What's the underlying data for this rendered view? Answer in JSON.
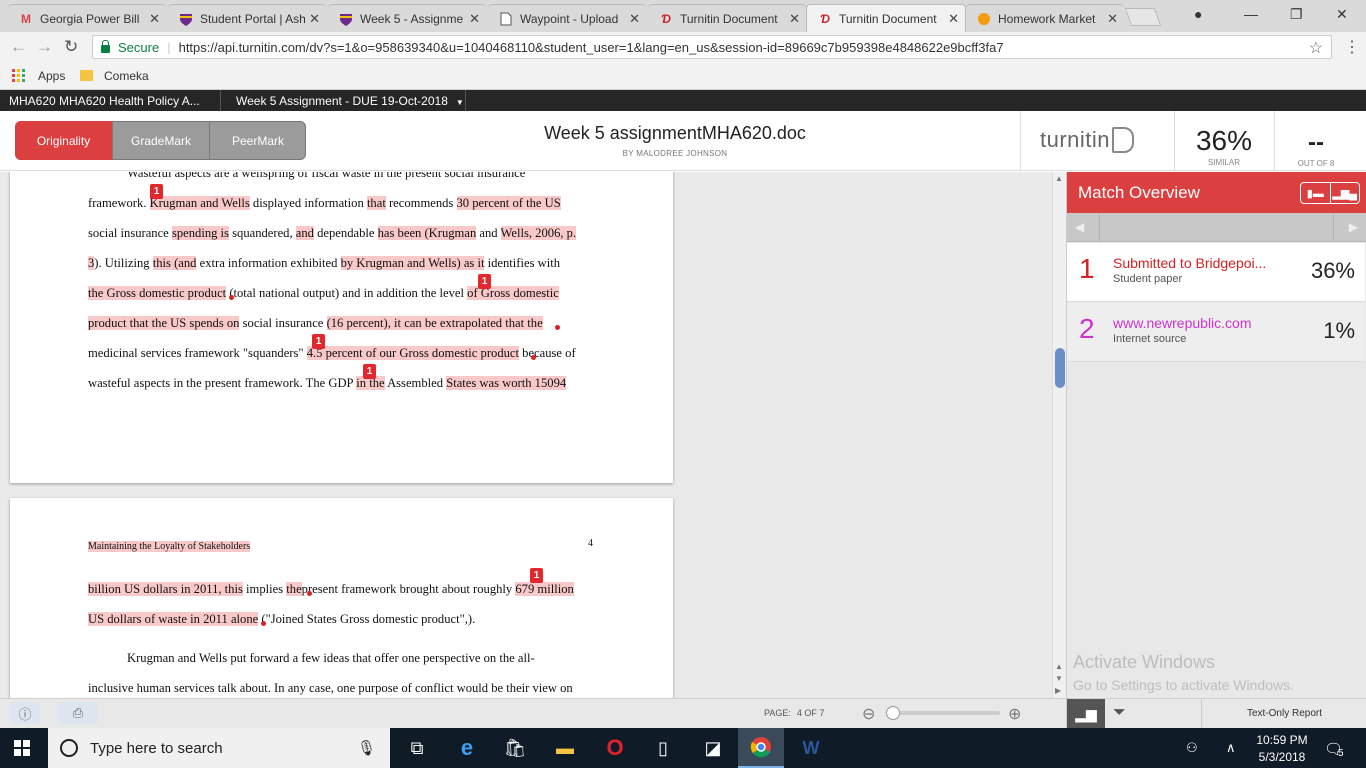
{
  "browser": {
    "tabs": [
      {
        "title": "Georgia Power Bill",
        "icon": "gmail-icon",
        "active": false
      },
      {
        "title": "Student Portal | Ash",
        "icon": "shield-icon",
        "active": false
      },
      {
        "title": "Week 5 - Assignme",
        "icon": "shield-icon",
        "active": false
      },
      {
        "title": "Waypoint - Upload",
        "icon": "document-icon",
        "active": false
      },
      {
        "title": "Turnitin Document",
        "icon": "turnitin-icon",
        "active": false
      },
      {
        "title": "Turnitin Document",
        "icon": "turnitin-icon",
        "active": true
      },
      {
        "title": "Homework Market",
        "icon": "homework-icon",
        "active": false
      }
    ],
    "secure_label": "Secure",
    "url": "https://api.turnitin.com/dv?s=1&o=958639340&u=1040468110&student_user=1&lang=en_us&session-id=89669c7b959398e4848622e9bcff3fa7",
    "bookmarks": {
      "apps": "Apps",
      "folder": "Comeka"
    }
  },
  "turnitin": {
    "breadcrumb_class": "MHA620 MHA620 Health Policy A...",
    "breadcrumb_assignment": "Week 5 Assignment - DUE 19-Oct-2018",
    "modes": [
      "Originality",
      "GradeMark",
      "PeerMark"
    ],
    "doc_title": "Week 5 assignmentMHA620.doc",
    "doc_author": "BY MALODREE JOHNSON",
    "logo": "turnitin",
    "similarity": "36%",
    "similarity_label": "SIMILAR",
    "grade": "--",
    "grade_label": "OUT OF 8"
  },
  "document": {
    "page1_lines": [
      "Wasteful aspects are a wellspring of fiscal waste in the present social insurance",
      "framework.",
      "Krugman and Wells",
      "displayed information",
      "that",
      "recommends",
      "30 percent of the US",
      "social insurance",
      "spending is",
      "squandered,",
      "and",
      "dependable",
      "has been (Krugman",
      "and",
      "Wells, 2006, p.",
      "3",
      "). Utilizing",
      "this (and",
      "extra information exhibited",
      "by Krugman and Wells) as it",
      "identifies with",
      "the Gross domestic product",
      "(total national output) and in addition the level",
      "of Gross domestic",
      "product that the US spends on",
      "social insurance",
      "(16 percent), it can be extrapolated that the",
      "medicinal services framework \"squanders\"",
      "4.5 percent of our Gross domestic product",
      "because of",
      "wasteful aspects in the present framework. The GDP",
      "in the",
      "Assembled",
      "States was worth 15094"
    ],
    "page2_header": "Maintaining the Loyalty of Stakeholders",
    "page2_number": "4",
    "page2_lines": [
      "billion US dollars in 2011, this",
      "implies",
      "the",
      "present framework brought about roughly",
      "679 million",
      "US dollars of waste in 2011 alone",
      "(\"Joined States Gross domestic product\",).",
      "Krugman and Wells put forward a few ideas that offer one perspective on the all-",
      "inclusive human services talk about. In any case, one purpose of conflict would be their view on"
    ],
    "match_marker": "1"
  },
  "panel": {
    "title": "Match Overview",
    "matches": [
      {
        "rank": "1",
        "source": "Submitted to Bridgepoi...",
        "type": "Student paper",
        "percent": "36%",
        "color": "#d42222"
      },
      {
        "rank": "2",
        "source": "www.newrepublic.com",
        "type": "Internet source",
        "percent": "1%",
        "color": "#cc33cc"
      }
    ],
    "watermark_title": "Activate Windows",
    "watermark_sub": "Go to Settings to activate Windows."
  },
  "status": {
    "page_label": "PAGE:",
    "page_value": "4 OF 7",
    "zoom_percent": 0,
    "text_only": "Text-Only Report"
  },
  "taskbar": {
    "search_placeholder": "Type here to search",
    "time": "10:59 PM",
    "date": "5/3/2018",
    "notifications": "5"
  }
}
